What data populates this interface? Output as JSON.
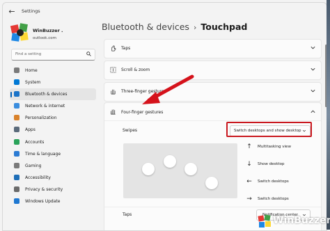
{
  "window": {
    "title": "Settings"
  },
  "profile": {
    "name": "WinBuzzer .",
    "email": "outlook.com"
  },
  "search": {
    "placeholder": "Find a setting"
  },
  "sidebar": {
    "items": [
      {
        "label": "Home",
        "icon": "home-icon",
        "color": "#7a7a7a"
      },
      {
        "label": "System",
        "icon": "system-icon",
        "color": "#0078d4"
      },
      {
        "label": "Bluetooth & devices",
        "icon": "bluetooth-icon",
        "color": "#1a73c8",
        "active": true
      },
      {
        "label": "Network & internet",
        "icon": "wifi-icon",
        "color": "#3a8dde"
      },
      {
        "label": "Personalization",
        "icon": "brush-icon",
        "color": "#d9822b"
      },
      {
        "label": "Apps",
        "icon": "apps-icon",
        "color": "#5b6b7b"
      },
      {
        "label": "Accounts",
        "icon": "person-icon",
        "color": "#2aa35a"
      },
      {
        "label": "Time & language",
        "icon": "globe-clock-icon",
        "color": "#2b7bd3"
      },
      {
        "label": "Gaming",
        "icon": "gamepad-icon",
        "color": "#7a7a7a"
      },
      {
        "label": "Accessibility",
        "icon": "accessibility-icon",
        "color": "#1f6fb8"
      },
      {
        "label": "Privacy & security",
        "icon": "shield-icon",
        "color": "#6b6b6b"
      },
      {
        "label": "Windows Update",
        "icon": "update-icon",
        "color": "#1f78d1"
      }
    ]
  },
  "breadcrumb": {
    "parent": "Bluetooth & devices",
    "separator": "›",
    "current": "Touchpad"
  },
  "sections": {
    "taps": "Taps",
    "scroll_zoom": "Scroll & zoom",
    "three_finger": "Three-finger gestures",
    "four_finger": "Four-finger gestures"
  },
  "four_finger": {
    "swipes_label": "Swipes",
    "swipes_value": "Switch desktops and show desktop",
    "motions": [
      {
        "arrow": "↑",
        "label": "Multitasking view"
      },
      {
        "arrow": "↓",
        "label": "Show desktop"
      },
      {
        "arrow": "←",
        "label": "Switch desktops"
      },
      {
        "arrow": "→",
        "label": "Switch desktops"
      }
    ],
    "taps_label": "Taps",
    "taps_value": "Notification center"
  },
  "watermark": {
    "text": "WinBuzzer"
  },
  "colors": {
    "accent": "#005fb8",
    "highlight": "#c9171e"
  }
}
